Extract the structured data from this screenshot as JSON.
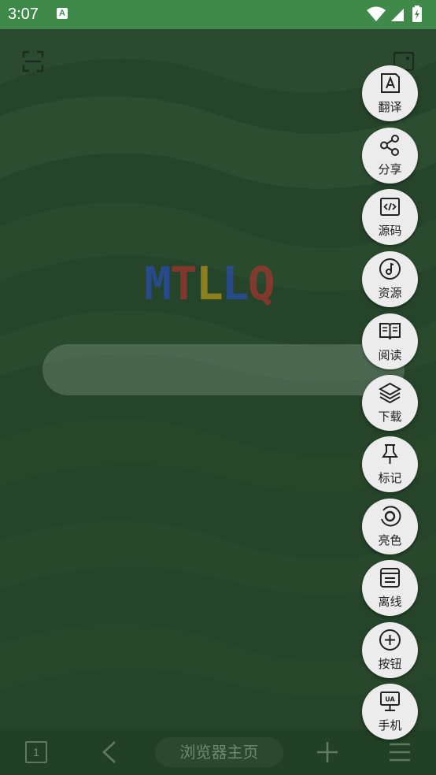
{
  "status_bar": {
    "time": "3:07",
    "notification_icon": "A"
  },
  "logo": {
    "letters": [
      {
        "ch": "M",
        "color": "#2a4fd8"
      },
      {
        "ch": "T",
        "color": "#c9302c"
      },
      {
        "ch": "L",
        "color": "#e0b018"
      },
      {
        "ch": "L",
        "color": "#2a4fd8"
      },
      {
        "ch": "Q",
        "color": "#c9302c"
      }
    ]
  },
  "fab_menu": [
    {
      "label": "翻译",
      "icon": "translate-icon"
    },
    {
      "label": "分享",
      "icon": "share-icon"
    },
    {
      "label": "源码",
      "icon": "source-code-icon"
    },
    {
      "label": "资源",
      "icon": "music-note-icon"
    },
    {
      "label": "阅读",
      "icon": "book-icon"
    },
    {
      "label": "下载",
      "icon": "layers-icon"
    },
    {
      "label": "标记",
      "icon": "pin-icon"
    },
    {
      "label": "亮色",
      "icon": "brightness-icon"
    },
    {
      "label": "离线",
      "icon": "offline-icon"
    },
    {
      "label": "按钮",
      "icon": "plus-circle-icon"
    },
    {
      "label": "手机",
      "icon": "ua-monitor-icon"
    }
  ],
  "bottom_bar": {
    "tab_count": "1",
    "home_label": "浏览器主页"
  }
}
